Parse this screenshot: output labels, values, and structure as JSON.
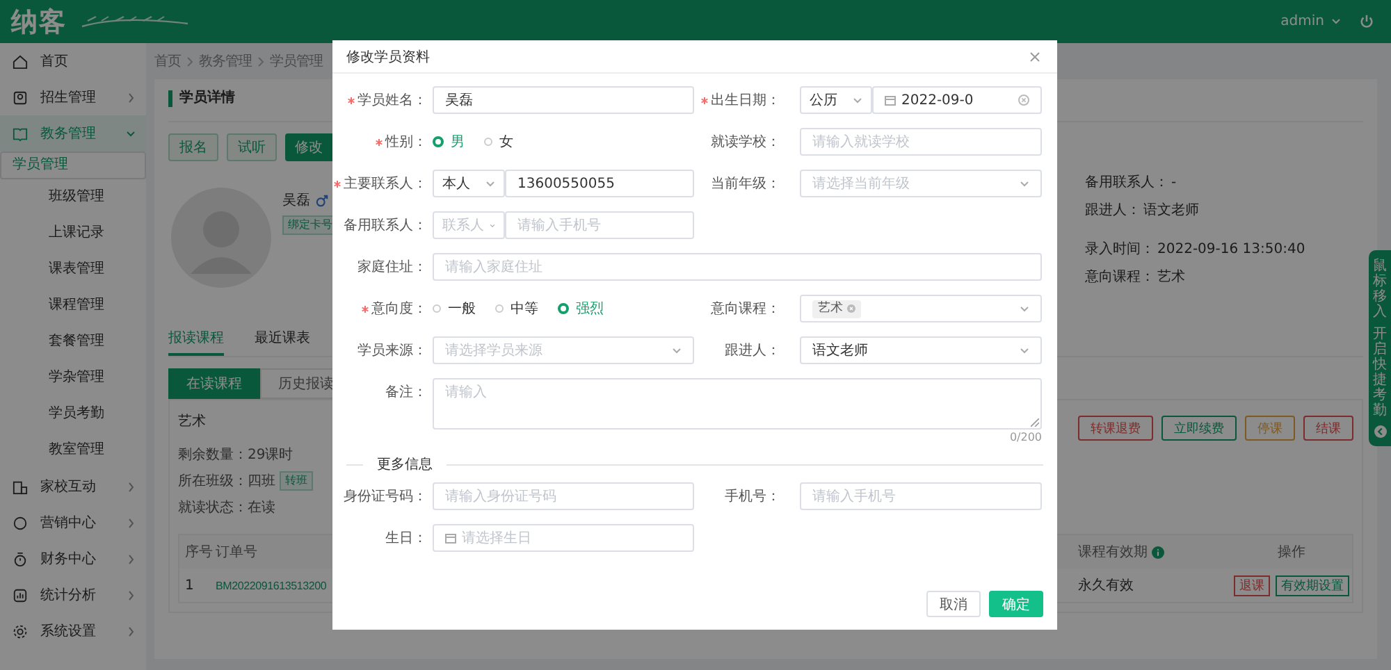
{
  "header": {
    "logo": "纳客",
    "user": "admin"
  },
  "sidebar": {
    "items": [
      {
        "label": "首页"
      },
      {
        "label": "招生管理",
        "expanded": false
      },
      {
        "label": "教务管理",
        "expanded": true,
        "children": [
          {
            "label": "学员管理",
            "selected": true
          },
          {
            "label": "班级管理",
            "selected": false
          },
          {
            "label": "上课记录",
            "selected": false
          },
          {
            "label": "课表管理",
            "selected": false
          },
          {
            "label": "课程管理",
            "selected": false
          },
          {
            "label": "套餐管理",
            "selected": false
          },
          {
            "label": "学杂管理",
            "selected": false
          },
          {
            "label": "学员考勤",
            "selected": false
          },
          {
            "label": "教室管理",
            "selected": false
          }
        ]
      },
      {
        "label": "家校互动",
        "expanded": false
      },
      {
        "label": "营销中心",
        "expanded": false
      },
      {
        "label": "财务中心",
        "expanded": false
      },
      {
        "label": "统计分析",
        "expanded": false
      },
      {
        "label": "系统设置",
        "expanded": false
      }
    ]
  },
  "breadcrumb": [
    "首页",
    "教务管理",
    "学员管理"
  ],
  "detail": {
    "title": "学员详情",
    "buttons": [
      {
        "label": "报名",
        "primary": false
      },
      {
        "label": "试听",
        "primary": false
      },
      {
        "label": "修改",
        "primary": true
      }
    ],
    "student": {
      "name": "吴磊",
      "badge": "绑定卡号"
    },
    "info_groups": [
      [
        {
          "label": "备用联系人：",
          "value": "-"
        },
        {
          "label": "跟进人：",
          "value": "语文老师"
        }
      ],
      [
        {
          "label": "录入时间：",
          "value": "2022-09-16 13:50:40"
        },
        {
          "label": "意向课程：",
          "value": "艺术"
        }
      ]
    ],
    "tabs": [
      {
        "label": "报读课程",
        "selected": true
      },
      {
        "label": "最近课表",
        "selected": false
      }
    ],
    "subtabs": [
      {
        "label": "在读课程",
        "selected": true
      },
      {
        "label": "历史报读",
        "selected": false
      }
    ],
    "course": {
      "name": "艺术",
      "lines": [
        {
          "label": "剩余数量：",
          "value": "29课时"
        },
        {
          "label": "所在班级：",
          "value": "四班",
          "tag": "转班"
        },
        {
          "label": "就读状态：",
          "value": "在读"
        }
      ],
      "actions": [
        {
          "label": "转课退费",
          "kind": "danger"
        },
        {
          "label": "立即续费",
          "kind": "primary"
        },
        {
          "label": "停课",
          "kind": "warning"
        },
        {
          "label": "结课",
          "kind": "danger"
        }
      ],
      "columns": [
        {
          "label": "序号"
        },
        {
          "label": "订单号"
        },
        {
          "label": "课程有效期",
          "info": true
        },
        {
          "label": "操作"
        }
      ],
      "rows": [
        {
          "cells": [
            "1",
            "BM2022091613513200",
            "永久有效"
          ],
          "ops": [
            {
              "label": "退课",
              "kind": "danger"
            },
            {
              "label": "有效期设置",
              "kind": "primary"
            }
          ]
        }
      ]
    }
  },
  "floating_tab": {
    "texts": [
      "鼠标移入",
      "开启快捷考勤"
    ]
  },
  "modal": {
    "title": "修改学员资料",
    "sections": [
      {
        "rows": [
          [
            {
              "label": "学员姓名：",
              "required": true,
              "kind": "input",
              "value": "吴磊"
            },
            {
              "label": "出生日期：",
              "required": true,
              "kind": "date-combo",
              "select": "公历",
              "value": "2022-09-0"
            }
          ],
          [
            {
              "label": "性别：",
              "required": true,
              "kind": "radio",
              "options": [
                {
                  "label": "男",
                  "selected": true
                },
                {
                  "label": "女",
                  "selected": false
                }
              ]
            },
            {
              "label": "就读学校：",
              "required": false,
              "kind": "input",
              "placeholder": "请输入就读学校"
            }
          ],
          [
            {
              "label": "主要联系人：",
              "required": true,
              "kind": "combo",
              "select": "本人",
              "value": "13600550055"
            },
            {
              "label": "当前年级：",
              "required": false,
              "kind": "select",
              "placeholder": "请选择当前年级"
            }
          ],
          [
            {
              "label": "备用联系人：",
              "required": false,
              "kind": "combo",
              "select_placeholder": "联系人",
              "placeholder": "请输入手机号"
            }
          ],
          [
            {
              "label": "家庭住址：",
              "required": false,
              "kind": "input",
              "wide": true,
              "placeholder": "请输入家庭住址"
            }
          ],
          [
            {
              "label": "意向度：",
              "required": true,
              "kind": "radio",
              "options": [
                {
                  "label": "一般",
                  "selected": false
                },
                {
                  "label": "中等",
                  "selected": false
                },
                {
                  "label": "强烈",
                  "selected": true
                }
              ]
            },
            {
              "label": "意向课程：",
              "required": false,
              "kind": "tags",
              "tags": [
                "艺术"
              ]
            }
          ],
          [
            {
              "label": "学员来源：",
              "required": false,
              "kind": "select",
              "placeholder": "请选择学员来源"
            },
            {
              "label": "跟进人：",
              "required": false,
              "kind": "select",
              "value": "语文老师"
            }
          ],
          [
            {
              "label": "备注：",
              "required": false,
              "kind": "textarea",
              "wide": true,
              "placeholder": "请输入",
              "count": "0/200"
            }
          ]
        ]
      },
      {
        "title": "更多信息",
        "rows": [
          [
            {
              "label": "身份证号码：",
              "required": false,
              "kind": "input",
              "placeholder": "请输入身份证号码"
            },
            {
              "label": "手机号：",
              "required": false,
              "kind": "input",
              "placeholder": "请输入手机号"
            }
          ],
          [
            {
              "label": "生日：",
              "required": false,
              "kind": "date",
              "placeholder": "请选择生日"
            }
          ]
        ]
      }
    ],
    "buttons": [
      {
        "label": "取消",
        "primary": false
      },
      {
        "label": "确定",
        "primary": true
      }
    ]
  }
}
